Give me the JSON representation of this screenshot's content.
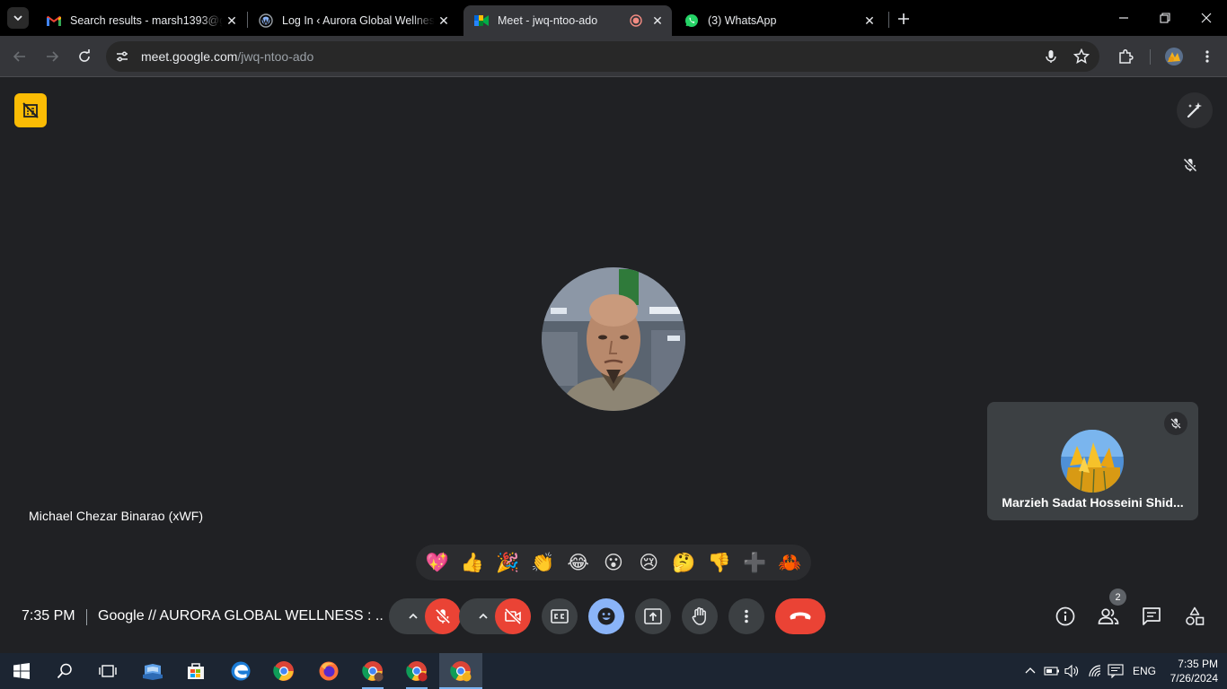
{
  "browser": {
    "tabs": [
      {
        "title": "Search results - marsh1393@gm",
        "icon": "gmail-icon"
      },
      {
        "title": "Log In ‹ Aurora Global Wellness",
        "icon": "wordpress-icon"
      },
      {
        "title": "Meet - jwq-ntoo-ado",
        "icon": "meet-icon",
        "active": true,
        "recording": true
      },
      {
        "title": "(3) WhatsApp",
        "icon": "whatsapp-icon"
      }
    ],
    "url_domain": "meet.google.com",
    "url_path": "/jwq-ntoo-ado"
  },
  "meet": {
    "main_participant_name": "Michael Chezar Binarao (xWF)",
    "self_participant_name": "Marzieh Sadat Hosseini Shid...",
    "reactions": [
      "💖",
      "👍",
      "🎉",
      "👏",
      "😂",
      "😮",
      "😢",
      "🤔",
      "👎",
      "➕",
      "🦀"
    ],
    "meeting_time": "7:35 PM",
    "meeting_title": "Google // AURORA GLOBAL WELLNESS : ...",
    "participant_count": "2",
    "colors": {
      "end_call": "#ea4335",
      "reactions_active": "#8ab4f8",
      "host_badge": "#fbbc04"
    }
  },
  "taskbar": {
    "language": "ENG",
    "time": "7:35 PM",
    "date": "7/26/2024"
  }
}
